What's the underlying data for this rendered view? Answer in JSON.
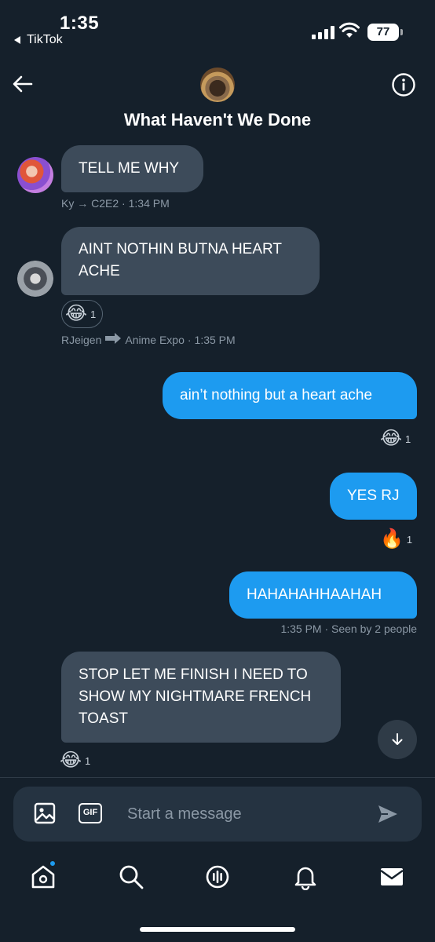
{
  "status_bar": {
    "time": "1:35",
    "back_app": "TikTok",
    "battery": "77"
  },
  "header": {
    "title": "What Haven't We Done"
  },
  "messages": [
    {
      "text": "TELL ME WHY",
      "meta_sender": "Ky",
      "meta_dest": "C2E2",
      "meta_time": "1:34 PM"
    },
    {
      "text": "AINT NOTHIN BUTNA HEART ACHE",
      "reaction_emoji": "😂",
      "reaction_count": "1",
      "meta_sender": "RJeigen",
      "meta_dest": "Anime Expo",
      "meta_time": "1:35 PM"
    },
    {
      "text": "ain’t nothing but a heart ache",
      "reaction_emoji": "😂",
      "reaction_count": "1"
    },
    {
      "text": "YES RJ",
      "reaction_emoji": "🔥",
      "reaction_count": "1"
    },
    {
      "text": "HAHAHAHHAAHAH",
      "meta": "1:35 PM · Seen by 2 people"
    },
    {
      "text": "STOP LET ME FINISH I NEED TO SHOW MY NIGHTMARE FRENCH TOAST",
      "reaction_emoji": "😂",
      "reaction_count": "1"
    }
  ],
  "composer": {
    "gif_label": "GIF",
    "placeholder": "Start a message"
  },
  "icons": {
    "back": "arrow-left-icon",
    "info": "info-circle-icon",
    "image": "image-icon",
    "send": "send-icon",
    "scroll": "arrow-down-icon",
    "nav": [
      "home-icon",
      "search-icon",
      "spaces-icon",
      "bell-icon",
      "mail-icon"
    ]
  },
  "colors": {
    "background": "#15202b",
    "incoming_bubble": "#3d4b5a",
    "outgoing_bubble": "#1d9bf0",
    "meta_text": "#8b98a5"
  }
}
